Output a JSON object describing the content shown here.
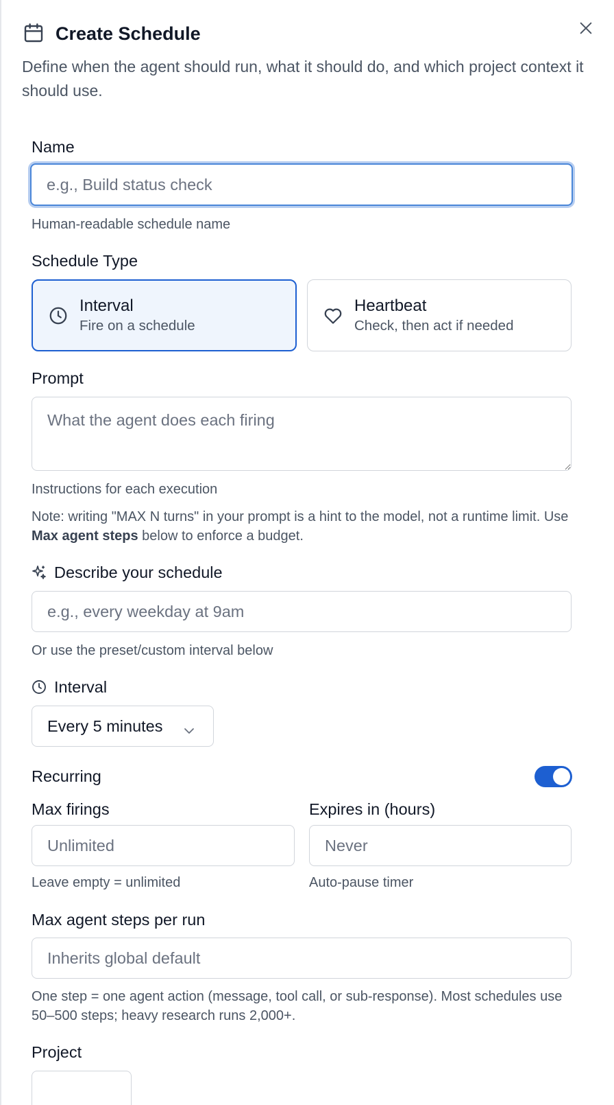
{
  "dialog": {
    "title": "Create Schedule",
    "description": "Define when the agent should run, what it should do, and which project context it should use.",
    "close_icon": "close-icon"
  },
  "name_field": {
    "label": "Name",
    "placeholder": "e.g., Build status check",
    "value": "",
    "hint": "Human-readable schedule name"
  },
  "schedule_type": {
    "label": "Schedule Type",
    "selected": "Interval",
    "options": [
      {
        "title": "Interval",
        "subtitle": "Fire on a schedule",
        "icon": "clock-icon"
      },
      {
        "title": "Heartbeat",
        "subtitle": "Check, then act if needed",
        "icon": "heart-icon"
      }
    ]
  },
  "prompt_field": {
    "label": "Prompt",
    "placeholder": "What the agent does each firing",
    "value": "",
    "hint": "Instructions for each execution",
    "note_prefix": "Note: writing \"MAX N turns\" in your prompt is a hint to the model, not a runtime limit. Use ",
    "note_bold": "Max agent steps",
    "note_suffix": " below to enforce a budget."
  },
  "describe_field": {
    "label": "Describe your schedule",
    "icon": "sparkles-icon",
    "placeholder": "e.g., every weekday at 9am",
    "value": "",
    "hint": "Or use the preset/custom interval below"
  },
  "interval_field": {
    "label": "Interval",
    "icon": "clock-icon",
    "selected": "Every 5 minutes"
  },
  "recurring": {
    "label": "Recurring",
    "enabled": true
  },
  "max_firings": {
    "label": "Max firings",
    "placeholder": "Unlimited",
    "value": "",
    "hint": "Leave empty = unlimited"
  },
  "expires": {
    "label": "Expires in (hours)",
    "placeholder": "Never",
    "value": "",
    "hint": "Auto-pause timer"
  },
  "max_steps": {
    "label": "Max agent steps per run",
    "placeholder": "Inherits global default",
    "value": "",
    "hint": "One step = one agent action (message, tool call, or sub-response). Most schedules use 50–500 steps; heavy research runs 2,000+."
  },
  "project": {
    "label": "Project"
  },
  "colors": {
    "accent": "#1d5fd1",
    "focus_ring": "#b6cdf0",
    "selected_card_bg": "#eff5fd",
    "text_muted": "#4b5563"
  }
}
